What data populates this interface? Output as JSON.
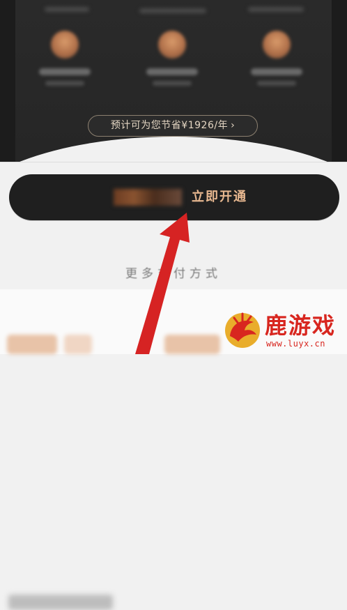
{
  "membership_panel": {
    "savings_text": "预计可为您节省¥1926/年",
    "savings_chevron": "›"
  },
  "cta": {
    "label": "立即开通"
  },
  "more_payment": {
    "label": "更多支付方式"
  },
  "watermark": {
    "name": "鹿游戏",
    "url": "www.luyx.cn"
  },
  "colors": {
    "panel_bg": "#262626",
    "cta_bg": "#1f1f1f",
    "cta_text": "#e8b890",
    "arrow": "#d62323",
    "watermark": "#d8261f"
  }
}
